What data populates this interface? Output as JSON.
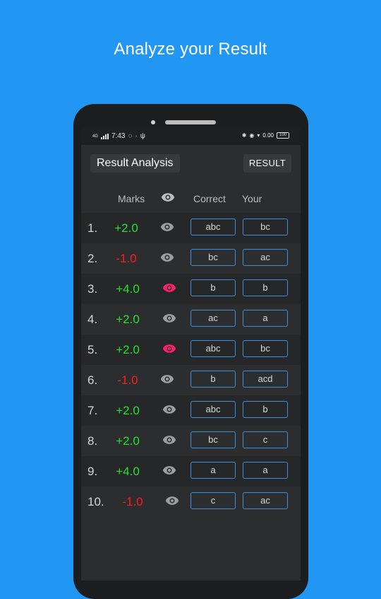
{
  "headline": "Analyze your Result",
  "status": {
    "time": "7:43",
    "network": "4G",
    "speed": "0.00",
    "battery": "100"
  },
  "appbar": {
    "title": "Result Analysis",
    "result_button": "RESULT"
  },
  "table": {
    "headers": {
      "marks": "Marks",
      "correct": "Correct",
      "your": "Your"
    },
    "rows": [
      {
        "num": "1.",
        "mark": "+2.0",
        "eye": "gray",
        "correct": "abc",
        "your": "bc"
      },
      {
        "num": "2.",
        "mark": "-1.0",
        "eye": "gray",
        "correct": "bc",
        "your": "ac"
      },
      {
        "num": "3.",
        "mark": "+4.0",
        "eye": "pink",
        "correct": "b",
        "your": "b"
      },
      {
        "num": "4.",
        "mark": "+2.0",
        "eye": "gray",
        "correct": "ac",
        "your": "a"
      },
      {
        "num": "5.",
        "mark": "+2.0",
        "eye": "pink",
        "correct": "abc",
        "your": "bc"
      },
      {
        "num": "6.",
        "mark": "-1.0",
        "eye": "gray",
        "correct": "b",
        "your": "acd"
      },
      {
        "num": "7.",
        "mark": "+2.0",
        "eye": "gray",
        "correct": "abc",
        "your": "b"
      },
      {
        "num": "8.",
        "mark": "+2.0",
        "eye": "gray",
        "correct": "bc",
        "your": "c"
      },
      {
        "num": "9.",
        "mark": "+4.0",
        "eye": "gray",
        "correct": "a",
        "your": "a"
      },
      {
        "num": "10.",
        "mark": "-1.0",
        "eye": "gray",
        "correct": "c",
        "your": "ac"
      }
    ]
  },
  "colors": {
    "background": "#2196f3",
    "positive": "#22e22a",
    "negative": "#ff1d1d",
    "eye_gray": "#9e9e9e",
    "eye_pink": "#ff1f6b",
    "box_border": "#3d8fd8"
  },
  "icons": {
    "eye": "eye-icon"
  }
}
